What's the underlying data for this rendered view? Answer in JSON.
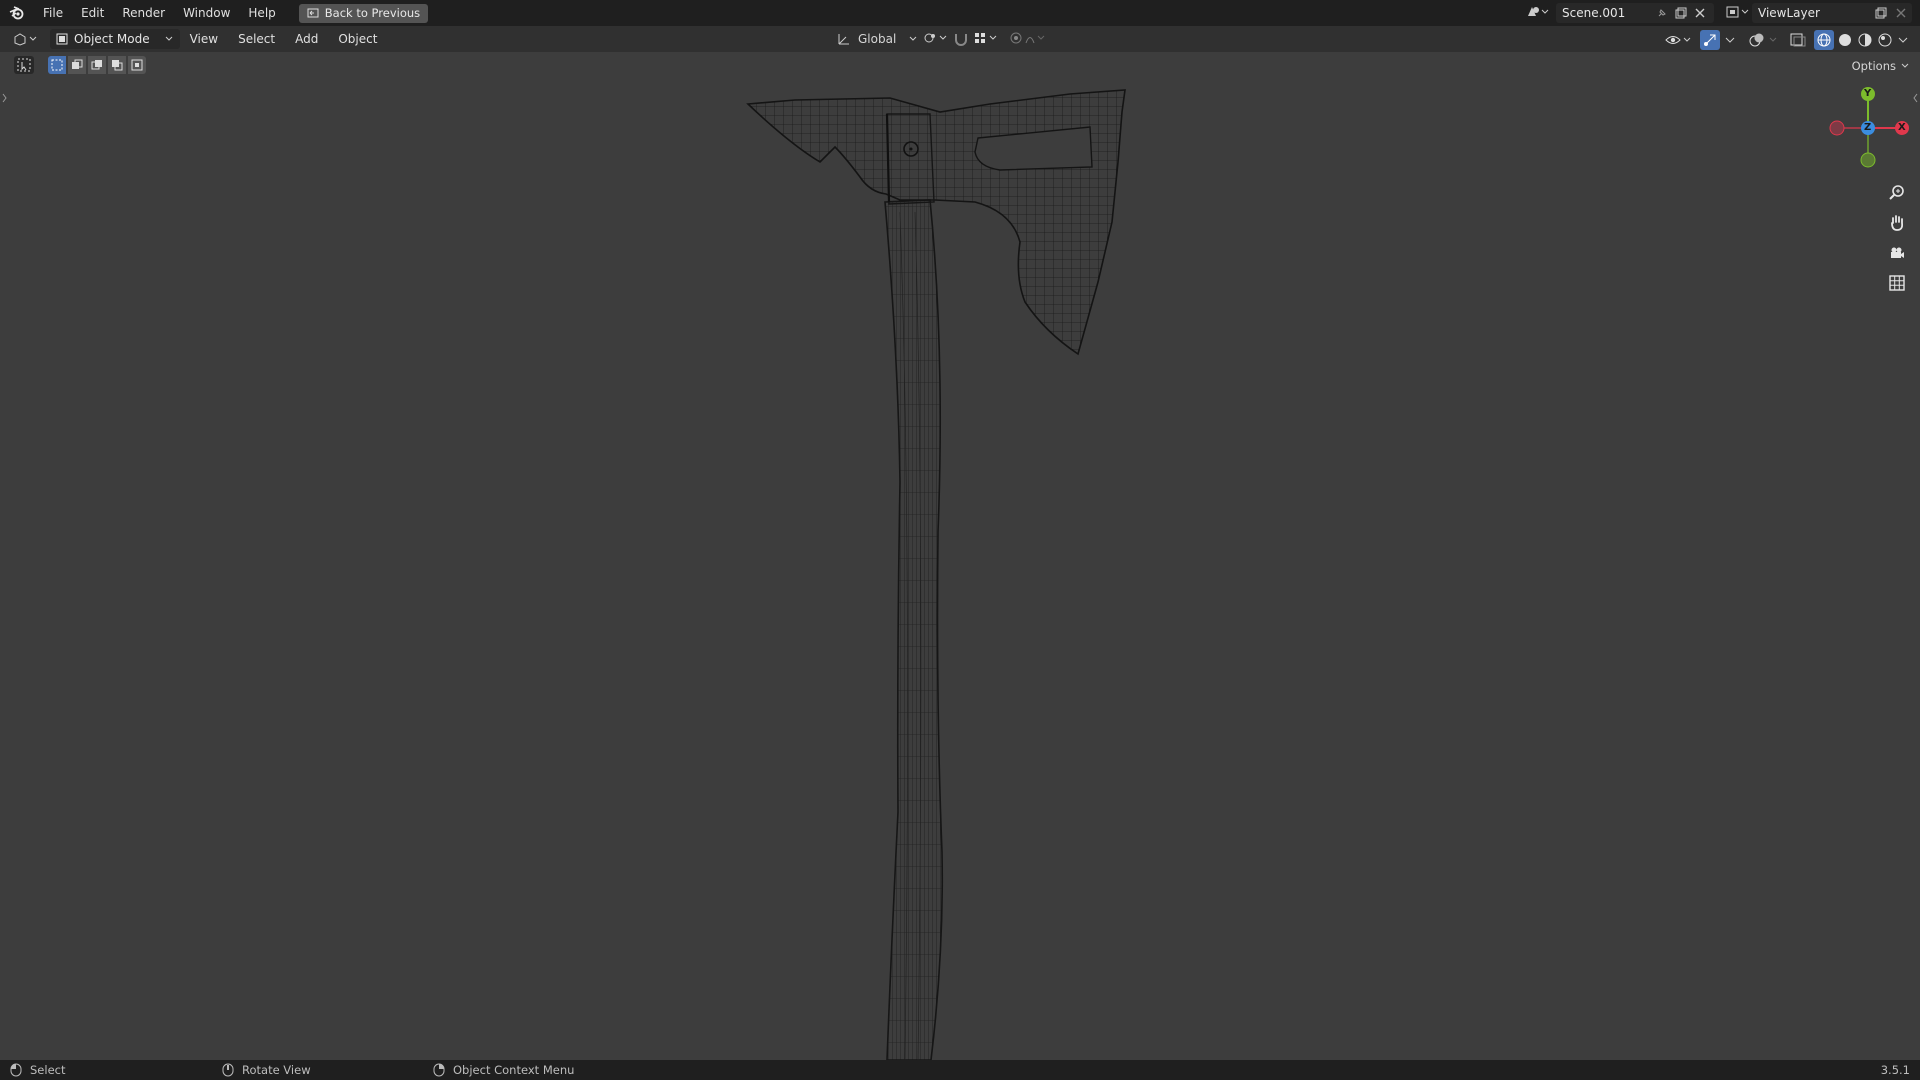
{
  "topbar": {
    "menus": [
      "File",
      "Edit",
      "Render",
      "Window",
      "Help"
    ],
    "back_label": "Back to Previous",
    "scene_name": "Scene.001",
    "view_layer": "ViewLayer"
  },
  "header": {
    "mode": "Object Mode",
    "menus": [
      "View",
      "Select",
      "Add",
      "Object"
    ],
    "transform_orientation": "Global",
    "options_label": "Options"
  },
  "gizmo": {
    "x_label": "X",
    "y_label": "Y",
    "z_label": "Z"
  },
  "statusbar": {
    "select": "Select",
    "rotate": "Rotate View",
    "context": "Object Context Menu",
    "version": "3.5.1"
  },
  "colors": {
    "topbar_bg": "#1f1f1f",
    "header_bg": "#303030",
    "viewport_bg": "#3d3d3d",
    "axis_x": "#e0384c",
    "axis_y": "#7cbc2c",
    "axis_z": "#3b8de0",
    "active_blue": "#4772b3"
  },
  "icons": [
    "blender-logo-icon",
    "back-icon",
    "scene-icon",
    "pin-icon",
    "duplicate-icon",
    "close-icon",
    "view-layer-icon",
    "editor-type-icon",
    "object-mode-icon",
    "transform-orientation-icon",
    "pivot-icon",
    "snap-icon",
    "proportional-edit-icon",
    "visibility-icon",
    "gizmo-icon",
    "overlay-icon",
    "xray-icon",
    "wireframe-shading-icon",
    "solid-shading-icon",
    "material-shading-icon",
    "rendered-shading-icon",
    "zoom-icon",
    "pan-hand-icon",
    "camera-icon",
    "grid-icon",
    "mouse-left-icon",
    "mouse-middle-icon",
    "mouse-right-icon"
  ]
}
